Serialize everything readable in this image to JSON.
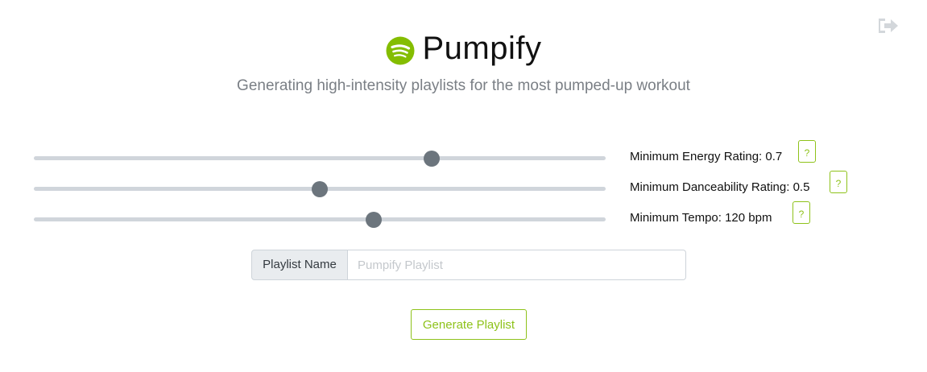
{
  "app": {
    "title": "Pumpify",
    "subtitle": "Generating high-intensity playlists for the most pumped-up workout",
    "brand_color": "#84bd00",
    "logo_icon": "spotify-logo-icon",
    "logout_icon": "sign-out-icon"
  },
  "sliders": [
    {
      "label": "Minimum Energy Rating: 0.7",
      "fraction": 0.696,
      "help_label": "?"
    },
    {
      "label": "Minimum Danceability Rating: 0.5",
      "fraction": 0.5,
      "help_label": "?"
    },
    {
      "label": "Minimum Tempo: 120 bpm",
      "fraction": 0.595,
      "help_label": "?"
    }
  ],
  "playlist": {
    "addon_label": "Playlist Name",
    "value": "",
    "placeholder": "Pumpify Playlist"
  },
  "generate_button": {
    "label": "Generate Playlist"
  }
}
